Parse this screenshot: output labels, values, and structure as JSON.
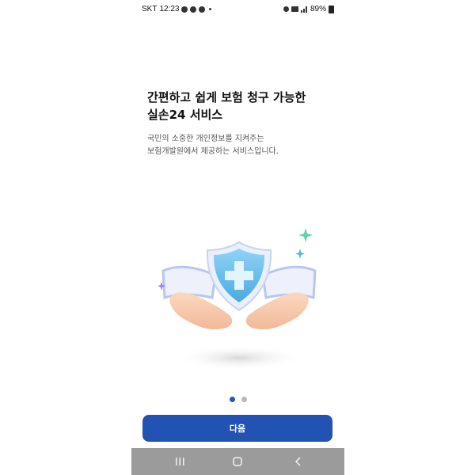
{
  "status_bar": {
    "carrier": "SKT",
    "time": "12:23",
    "battery": "89%"
  },
  "onboarding": {
    "title_line1": "간편하고 쉽게 보험 청구 가능한",
    "title_line2": "실손24 서비스",
    "desc_line1": "국민의 소중한 개인정보를 지켜주는",
    "desc_line2": "보험개발원에서 제공하는 서비스입니다."
  },
  "pagination": {
    "total": 2,
    "current": 1
  },
  "next_button": {
    "label": "다음"
  },
  "colors": {
    "accent": "#2252b4",
    "shield": "#6ec3ee",
    "sparkle_green": "#5fd3a6",
    "sparkle_blue": "#59b6e8",
    "sparkle_purple": "#9a84e0"
  },
  "nav_bar": {
    "recent_icon": "recent-apps-icon",
    "home_icon": "home-icon",
    "back_icon": "back-icon"
  }
}
